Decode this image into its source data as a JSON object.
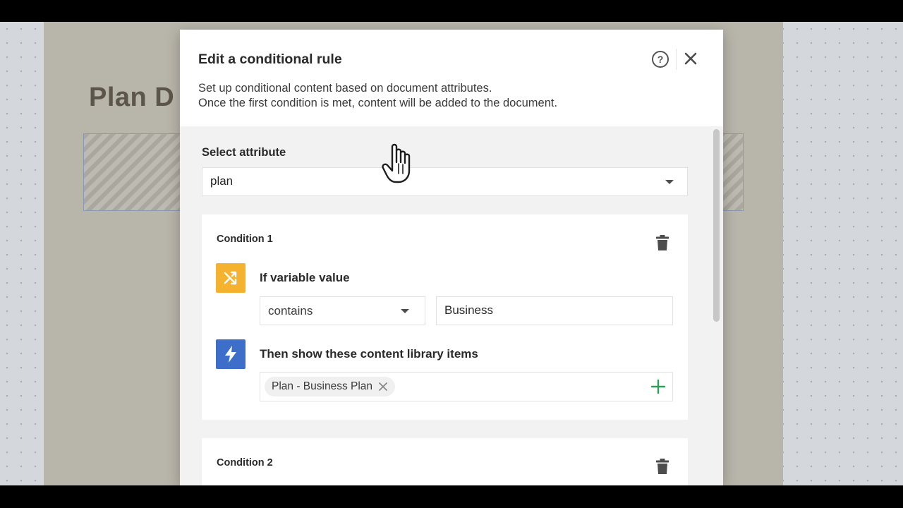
{
  "background_doc": {
    "title": "Plan D"
  },
  "modal": {
    "title": "Edit a conditional rule",
    "description_line1": "Set up conditional content based on document attributes.",
    "description_line2": "Once the first condition is met, content will be added to the document.",
    "help_icon_glyph": "?"
  },
  "attribute": {
    "label": "Select attribute",
    "value": "plan"
  },
  "conditions": [
    {
      "title": "Condition 1",
      "if_label": "If variable value",
      "operator": "contains",
      "value": "Business",
      "then_label": "Then show these content library items",
      "items": [
        "Plan - Business Plan"
      ]
    },
    {
      "title": "Condition 2"
    }
  ],
  "colors": {
    "if_tile": "#f4b22e",
    "then_tile": "#3d6ec9",
    "add_icon": "#2e9e5b"
  },
  "icons": {
    "help": "help-circle-icon",
    "close": "close-icon",
    "delete": "trash-icon",
    "if": "shuffle-icon",
    "then": "lightning-icon",
    "add": "plus-icon",
    "remove_item": "x-icon",
    "cursor": "hand-cursor-icon"
  }
}
